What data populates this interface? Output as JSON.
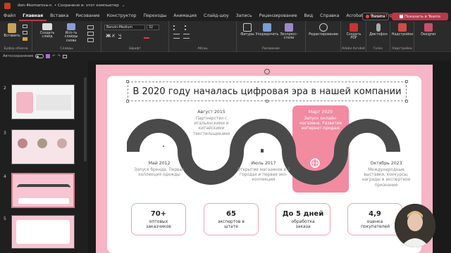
{
  "window": {
    "title": "den-4komarova-n. • Сохранено в: этот компьютер",
    "caret": "⌄"
  },
  "tabs": [
    "Файл",
    "Главная",
    "Вставка",
    "Рисование",
    "Конструктор",
    "Переходы",
    "Анимация",
    "Слайд-шоу",
    "Запись",
    "Рецензирование",
    "Вид",
    "Справка",
    "Acrobat",
    "Формат фигуры"
  ],
  "header_buttons": {
    "record": "Запись",
    "share": "Показать в Teams"
  },
  "ribbon": {
    "paste": "Вставить",
    "clipboard_label": "Буфер обмена",
    "new_slide": "Создать слайд",
    "reuse": "Исп-ть слайды снова",
    "slides_label": "Слайды",
    "font_name": "Benzin-Medium",
    "font_size": "32",
    "font_label": "Шрифт",
    "paragraph_label": "Абзац",
    "shapes": "Фигуры",
    "arrange": "Упорядочить",
    "styles": "Экспресс-стили",
    "drawing_label": "Рисование",
    "editing": "Редактирование",
    "pdf": "Создать PDF",
    "acrobat_label": "Adobe Acrobat",
    "dictate": "Диктофон",
    "voice_label": "Голос",
    "addins": "Надстройки",
    "addins_label": "Надстройки",
    "designer": "Designer"
  },
  "qat": {
    "autosave": "Автосохранение"
  },
  "thumbs": [
    "2",
    "3",
    "4",
    "5"
  ],
  "slide": {
    "title": "В 2020 году началась цифровая эра в нашей компании",
    "milestones": [
      {
        "date": "Май 2012",
        "desc": "Запуск бренда. Первая коллекция одежды"
      },
      {
        "date": "Август 2015",
        "desc": "Партнерство с итальянскими и китайскими текстильщиками"
      },
      {
        "date": "Июль 2017",
        "desc": "Открытие магазинов в 5 городах и первая эко-коллекция"
      },
      {
        "date": "Март 2020",
        "desc": "Запуск онлайн-магазина. Развитие интернет-продаж"
      },
      {
        "date": "Октябрь 2023",
        "desc": "Международные выставки, конкурсы, награды и экспертное признание"
      }
    ],
    "stats": [
      {
        "value": "70+",
        "caption": "оптовых заказчиков"
      },
      {
        "value": "65",
        "caption": "экспертов в штате"
      },
      {
        "value": "До 5 дней",
        "caption": "обработка заказа"
      },
      {
        "value": "4,9",
        "caption": "оценка покупателей"
      }
    ]
  },
  "colors": {
    "accent": "#b8394a",
    "pink": "#f28aa0",
    "slide_bg": "#f7b5c5",
    "dark": "#4a4a4a"
  }
}
